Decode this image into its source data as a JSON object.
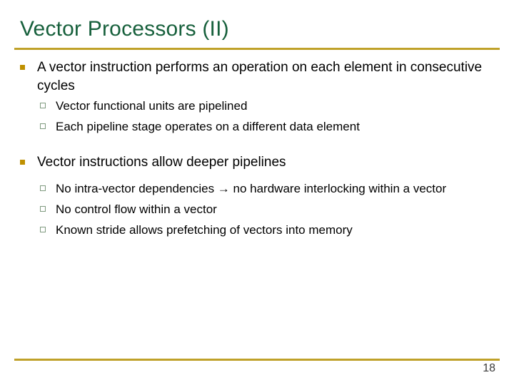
{
  "slide": {
    "title": "Vector Processors (II)",
    "page_number": "18",
    "colors": {
      "title_green": "#17603C",
      "rule_gold": "#BFA129",
      "bullet_gold": "#BF9000",
      "subbullet_outline": "#7F9A7F",
      "body_text": "#000000",
      "page_number": "#3A3A3A",
      "background": "#FFFFFF"
    },
    "bullets": [
      {
        "text": "A vector instruction performs an operation on each element in consecutive cycles",
        "marker": "filled-square-gold",
        "sub_bullets": [
          {
            "text": "Vector functional units are pipelined",
            "marker": "hollow-square-green"
          },
          {
            "text": "Each pipeline stage operates on a different data element",
            "marker": "hollow-square-green"
          }
        ]
      },
      {
        "text": "Vector instructions allow deeper pipelines",
        "marker": "filled-square-gold",
        "sub_bullets": [
          {
            "text": "No intra-vector dependencies → no hardware interlocking within a vector",
            "marker": "hollow-square-green"
          },
          {
            "text": "No control flow within a vector",
            "marker": "hollow-square-green"
          },
          {
            "text": "Known stride allows prefetching of vectors into memory",
            "marker": "hollow-square-green"
          }
        ]
      }
    ]
  }
}
